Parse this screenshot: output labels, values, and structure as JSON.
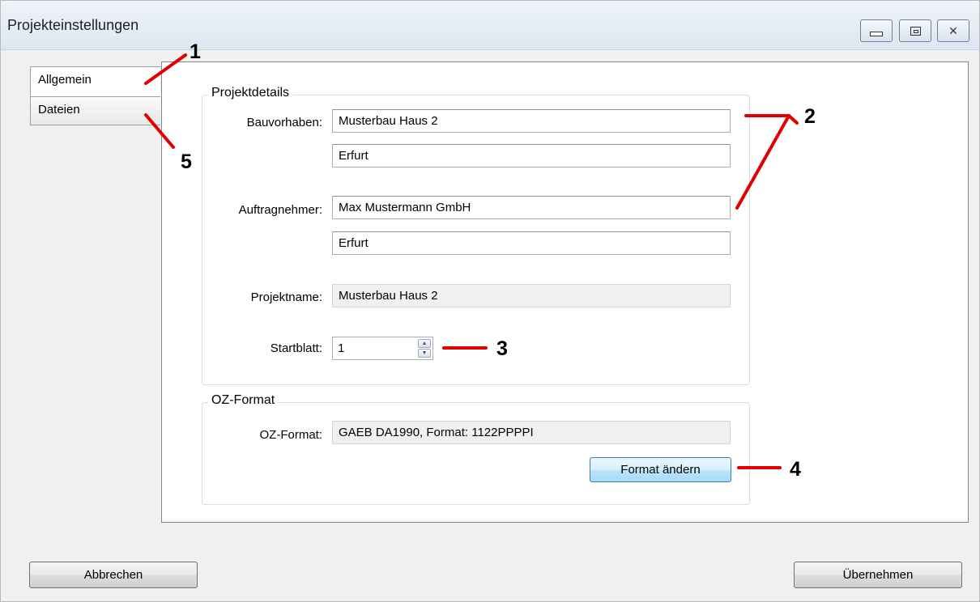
{
  "window": {
    "title": "Projekteinstellungen"
  },
  "tabs": [
    {
      "label": "Allgemein",
      "active": true
    },
    {
      "label": "Dateien",
      "active": false
    }
  ],
  "projektdetails": {
    "legend": "Projektdetails",
    "bauvorhaben_label": "Bauvorhaben:",
    "bauvorhaben_line1": "Musterbau Haus 2",
    "bauvorhaben_line2": "Erfurt",
    "auftragnehmer_label": "Auftragnehmer:",
    "auftragnehmer_line1": "Max Mustermann GmbH",
    "auftragnehmer_line2": "Erfurt",
    "projektname_label": "Projektname:",
    "projektname_value": "Musterbau Haus 2",
    "startblatt_label": "Startblatt:",
    "startblatt_value": "1"
  },
  "oz_format": {
    "legend": "OZ-Format",
    "label": "OZ-Format:",
    "value": "GAEB DA1990, Format: 1122PPPPI",
    "change_button": "Format ändern"
  },
  "footer": {
    "cancel": "Abbrechen",
    "apply": "Übernehmen"
  },
  "callouts": [
    "1",
    "2",
    "3",
    "4",
    "5"
  ],
  "colors": {
    "annotation": "#e00000",
    "focus_button": "#bee6fd"
  },
  "icons": {
    "minimize": "minimize-icon",
    "maximize": "maximize-icon",
    "close": "close-icon",
    "spin_up": "spin-up-icon",
    "spin_down": "spin-down-icon"
  }
}
